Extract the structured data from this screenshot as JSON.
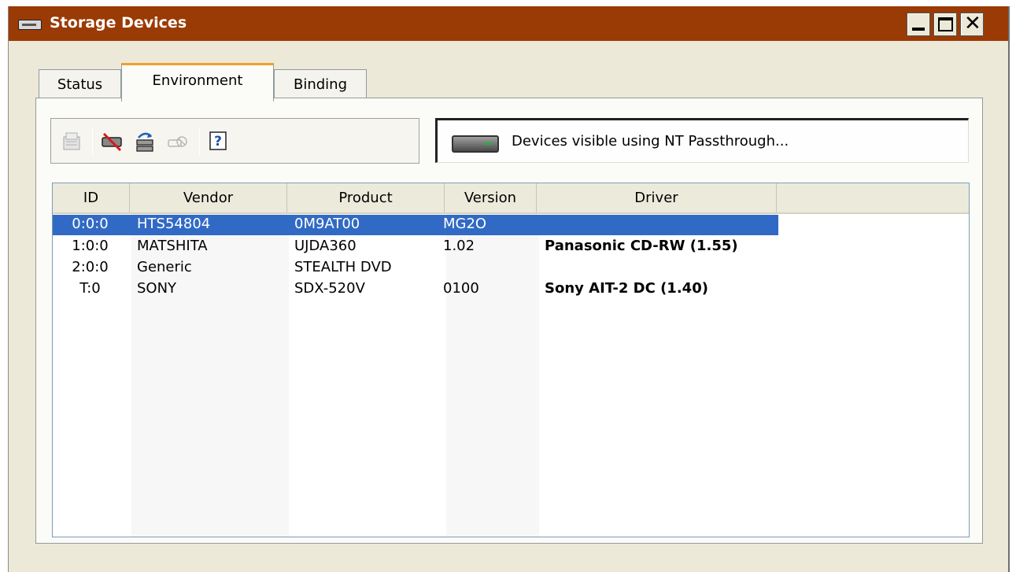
{
  "window": {
    "title": "Storage Devices",
    "controls": {
      "minimize": "minimize",
      "maximize": "maximize",
      "close": "✕"
    }
  },
  "tabs": [
    {
      "label": "Status",
      "selected": false
    },
    {
      "label": "Environment",
      "selected": true
    },
    {
      "label": "Binding",
      "selected": false
    }
  ],
  "toolbar": {
    "buttons": [
      {
        "icon": "properties-icon",
        "enabled": false
      },
      {
        "icon": "remove-device-icon",
        "enabled": true
      },
      {
        "icon": "refresh-devices-icon",
        "enabled": true
      },
      {
        "icon": "offline-icon",
        "enabled": false
      },
      {
        "icon": "help-icon",
        "enabled": true
      }
    ]
  },
  "status": {
    "icon": "drive-icon",
    "text": "Devices visible using NT Passthrough..."
  },
  "devices": {
    "columns": {
      "id": "ID",
      "vendor": "Vendor",
      "product": "Product",
      "version": "Version",
      "driver": "Driver"
    },
    "rows": [
      {
        "id": "0:0:0",
        "vendor": "HTS54804",
        "product": "0M9AT00",
        "version": "MG2O",
        "driver": "",
        "selected": true
      },
      {
        "id": "1:0:0",
        "vendor": "MATSHITA",
        "product": "UJDA360",
        "version": "1.02",
        "driver": "Panasonic CD-RW (1.55)",
        "selected": false
      },
      {
        "id": "2:0:0",
        "vendor": "Generic",
        "product": "STEALTH DVD",
        "version": "",
        "driver": "",
        "selected": false
      },
      {
        "id": "T:0",
        "vendor": "SONY",
        "product": "SDX-520V",
        "version": "0100",
        "driver": "Sony AIT-2 DC (1.40)",
        "selected": false
      }
    ]
  },
  "colors": {
    "titlebar": "#9a3a04",
    "selection": "#316ac5",
    "tab_highlight": "#f0a030",
    "window_bg": "#ece9d8"
  }
}
